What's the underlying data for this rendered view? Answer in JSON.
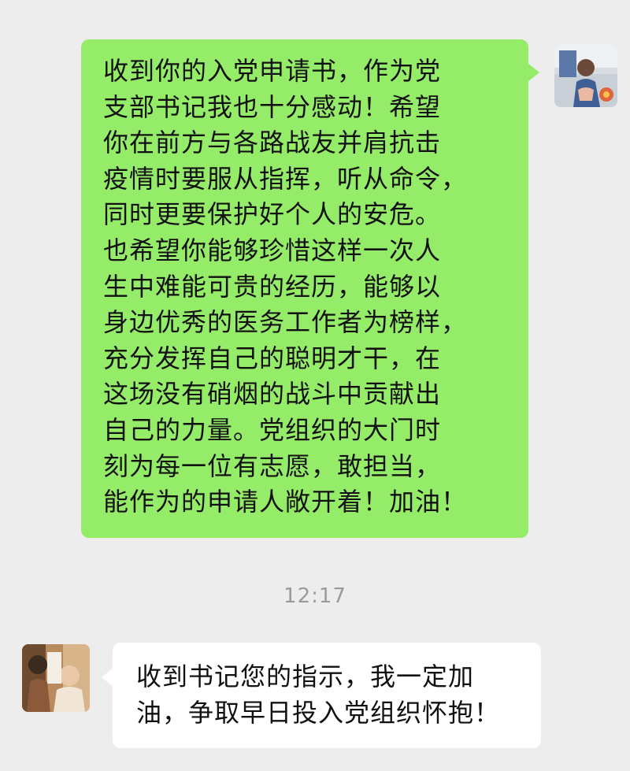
{
  "messages": [
    {
      "sender": "me",
      "text": "收到你的入党申请书，作为党\n支部书记我也十分感动！希望\n你在前方与各路战友并肩抗击\n疫情时要服从指挥，听从命令，\n同时更要保护好个人的安危。\n也希望你能够珍惜这样一次人\n生中难能可贵的经历，能够以\n身边优秀的医务工作者为榜样，\n充分发挥自己的聪明才干，在\n这场没有硝烟的战斗中贡献出\n自己的力量。党组织的大门时\n刻为每一位有志愿，敢担当，\n能作为的申请人敞开着！加油！"
    },
    {
      "sender": "other",
      "text": "收到书记您的指示，我一定加\n油，争取早日投入党组织怀抱！"
    }
  ],
  "timestamp": "12:17",
  "colors": {
    "background": "#ededed",
    "outgoing_bubble": "#95ec69",
    "incoming_bubble": "#ffffff",
    "timestamp_text": "#9b9b9b"
  }
}
